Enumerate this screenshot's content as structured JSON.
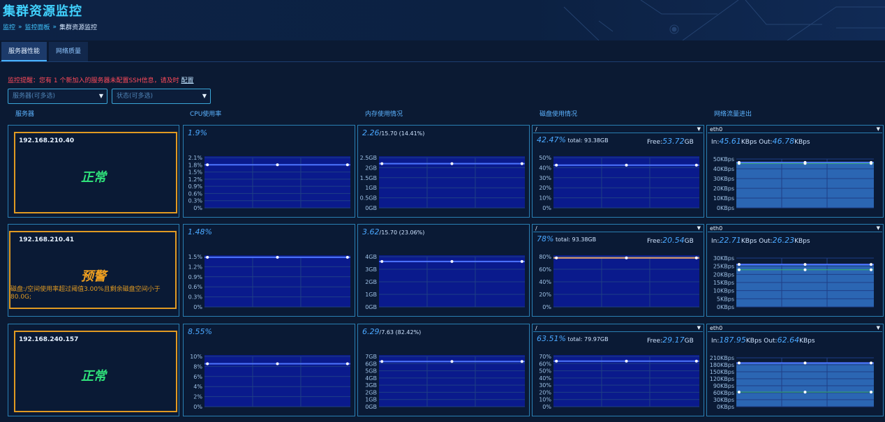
{
  "page": {
    "title": "集群资源监控",
    "breadcrumb": [
      "监控",
      "监控面板",
      "集群资源监控"
    ],
    "breadcrumb_sep": "»"
  },
  "tabs": [
    "服务器性能",
    "网络质量"
  ],
  "notice": {
    "text": "监控提醒：您有 1 个新加入的服务器未配置SSH信息，请及时 ",
    "link": "配置"
  },
  "filters": {
    "server_placeholder": "服务器(可多选)",
    "status_placeholder": "状态(可多选)"
  },
  "columns": [
    "服务器",
    "CPU使用率",
    "内存使用情况",
    "磁盘使用情况",
    "网络流量进出"
  ],
  "colors": {
    "accent": "#41d3ff",
    "ok": "#2fe07a",
    "warn": "#f0a020",
    "bar_fill": "#0a1a8c",
    "net_fill": "#2b66b3"
  },
  "servers": [
    {
      "ip": "192.168.210.40",
      "status": "正常",
      "status_kind": "ok",
      "warning": "",
      "cpu": {
        "label": "1.9%",
        "ticks": [
          "2.1%",
          "1.8%",
          "1.5%",
          "1.2%",
          "0.9%",
          "0.6%",
          "0.3%",
          "0%"
        ],
        "level": 0.857
      },
      "mem": {
        "used": "2.26",
        "total": "/15.70",
        "pct": " (14.41%)",
        "ticks": [
          "2.5GB",
          "2GB",
          "1.5GB",
          "1GB",
          "0.5GB",
          "0GB"
        ],
        "level": 0.88
      },
      "disk": {
        "mount": "/",
        "pct": "42.47%",
        "total_label": " total: ",
        "total": "93.38GB",
        "free_label": "Free:",
        "free": "53.72",
        "free_unit": "GB",
        "ticks": [
          "50%",
          "40%",
          "30%",
          "20%",
          "10%",
          "0%"
        ],
        "level": 0.85
      },
      "net": {
        "iface": "eth0",
        "in_label": "In:",
        "in": "45.61",
        "unit_in": "KBps Out:",
        "out": "46.78",
        "unit_out": "KBps",
        "ticks": [
          "50KBps",
          "40KBps",
          "30KBps",
          "20KBps",
          "10KBps",
          "0KBps"
        ],
        "level": 0.93,
        "line2": 0.91
      }
    },
    {
      "ip": "192.168.210.41",
      "status": "预警",
      "status_kind": "warn",
      "warning": "磁盘:/空间使用率超过阈值3.00%且剩余磁盘空间小于80.0G;",
      "cpu": {
        "label": "1.48%",
        "ticks": [
          "1.5%",
          "1.2%",
          "0.9%",
          "0.6%",
          "0.3%",
          "0%"
        ],
        "level": 0.987
      },
      "mem": {
        "used": "3.62",
        "total": "/15.70",
        "pct": " (23.06%)",
        "ticks": [
          "4GB",
          "3GB",
          "2GB",
          "1GB",
          "0GB"
        ],
        "level": 0.905
      },
      "disk": {
        "mount": "/",
        "pct": "78%",
        "total_label": " total: ",
        "total": "93.38GB",
        "free_label": "Free:",
        "free": "20.54",
        "free_unit": "GB",
        "ticks": [
          "80%",
          "60%",
          "40%",
          "20%",
          "0%"
        ],
        "level": 0.975
      },
      "net": {
        "iface": "eth0",
        "in_label": "In:",
        "in": "22.71",
        "unit_in": "KBps Out:",
        "out": "26.23",
        "unit_out": "KBps",
        "ticks": [
          "30KBps",
          "25KBps",
          "20KBps",
          "15KBps",
          "10KBps",
          "5KBps",
          "0KBps"
        ],
        "level": 0.87,
        "line2": 0.76
      }
    },
    {
      "ip": "192.168.240.157",
      "status": "正常",
      "status_kind": "ok",
      "warning": "",
      "cpu": {
        "label": "8.55%",
        "ticks": [
          "10%",
          "8%",
          "6%",
          "4%",
          "2%",
          "0%"
        ],
        "level": 0.855
      },
      "mem": {
        "used": "6.29",
        "total": "/7.63",
        "pct": " (82.42%)",
        "ticks": [
          "7GB",
          "6GB",
          "5GB",
          "4GB",
          "3GB",
          "2GB",
          "1GB",
          "0GB"
        ],
        "level": 0.9
      },
      "disk": {
        "mount": "/",
        "pct": "63.51%",
        "total_label": " total: ",
        "total": "79.97GB",
        "free_label": "Free:",
        "free": "29.17",
        "free_unit": "GB",
        "ticks": [
          "70%",
          "60%",
          "50%",
          "40%",
          "30%",
          "20%",
          "10%",
          "0%"
        ],
        "level": 0.907
      },
      "net": {
        "iface": "eth0",
        "in_label": "In:",
        "in": "187.95",
        "unit_in": "KBps Out:",
        "out": "62.64",
        "unit_out": "KBps",
        "ticks": [
          "210KBps",
          "180KBps",
          "150KBps",
          "120KBps",
          "90KBps",
          "60KBps",
          "30KBps",
          "0KBps"
        ],
        "level": 0.895,
        "line2": 0.298
      }
    }
  ]
}
